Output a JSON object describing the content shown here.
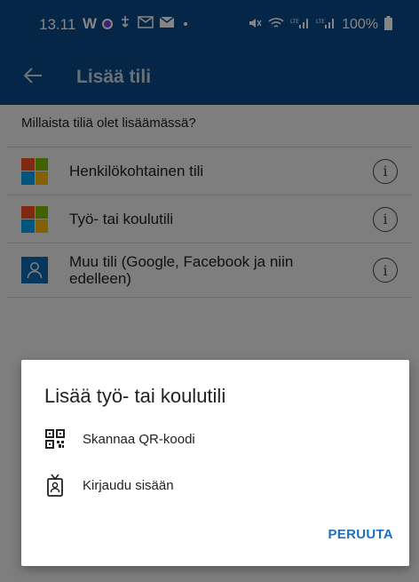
{
  "status_bar": {
    "time": "13.11",
    "left_icons": [
      "w-icon",
      "purple-dot-icon",
      "usb-icon",
      "email-app-icon",
      "mail-icon",
      "dot-icon"
    ],
    "battery_text": "100%",
    "right_icons": [
      "mute-icon",
      "wifi-icon",
      "lte-signal-icon",
      "lte-signal-icon-2",
      "battery-icon"
    ]
  },
  "app_bar": {
    "back_icon": "arrow-left-icon",
    "title": "Lisää tili"
  },
  "main": {
    "question": "Millaista tiliä olet lisäämässä?",
    "accounts": [
      {
        "label": "Henkilökohtainen tili",
        "icon": "microsoft-logo-icon"
      },
      {
        "label": "Työ- tai koulutili",
        "icon": "microsoft-logo-icon"
      },
      {
        "label": "Muu tili (Google, Facebook ja niin edelleen)",
        "icon": "person-icon"
      }
    ]
  },
  "dialog": {
    "title": "Lisää työ- tai koulutili",
    "options": [
      {
        "label": "Skannaa QR-koodi",
        "icon": "qr-code-icon"
      },
      {
        "label": "Kirjaudu sisään",
        "icon": "badge-icon"
      }
    ],
    "cancel_label": "PERUUTA"
  },
  "colors": {
    "app_bar": "#0b4a86",
    "accent": "#1e6fc0",
    "ms_red": "#f25022",
    "ms_green": "#7fba00",
    "ms_blue": "#00a4ef",
    "ms_yellow": "#ffb900"
  }
}
